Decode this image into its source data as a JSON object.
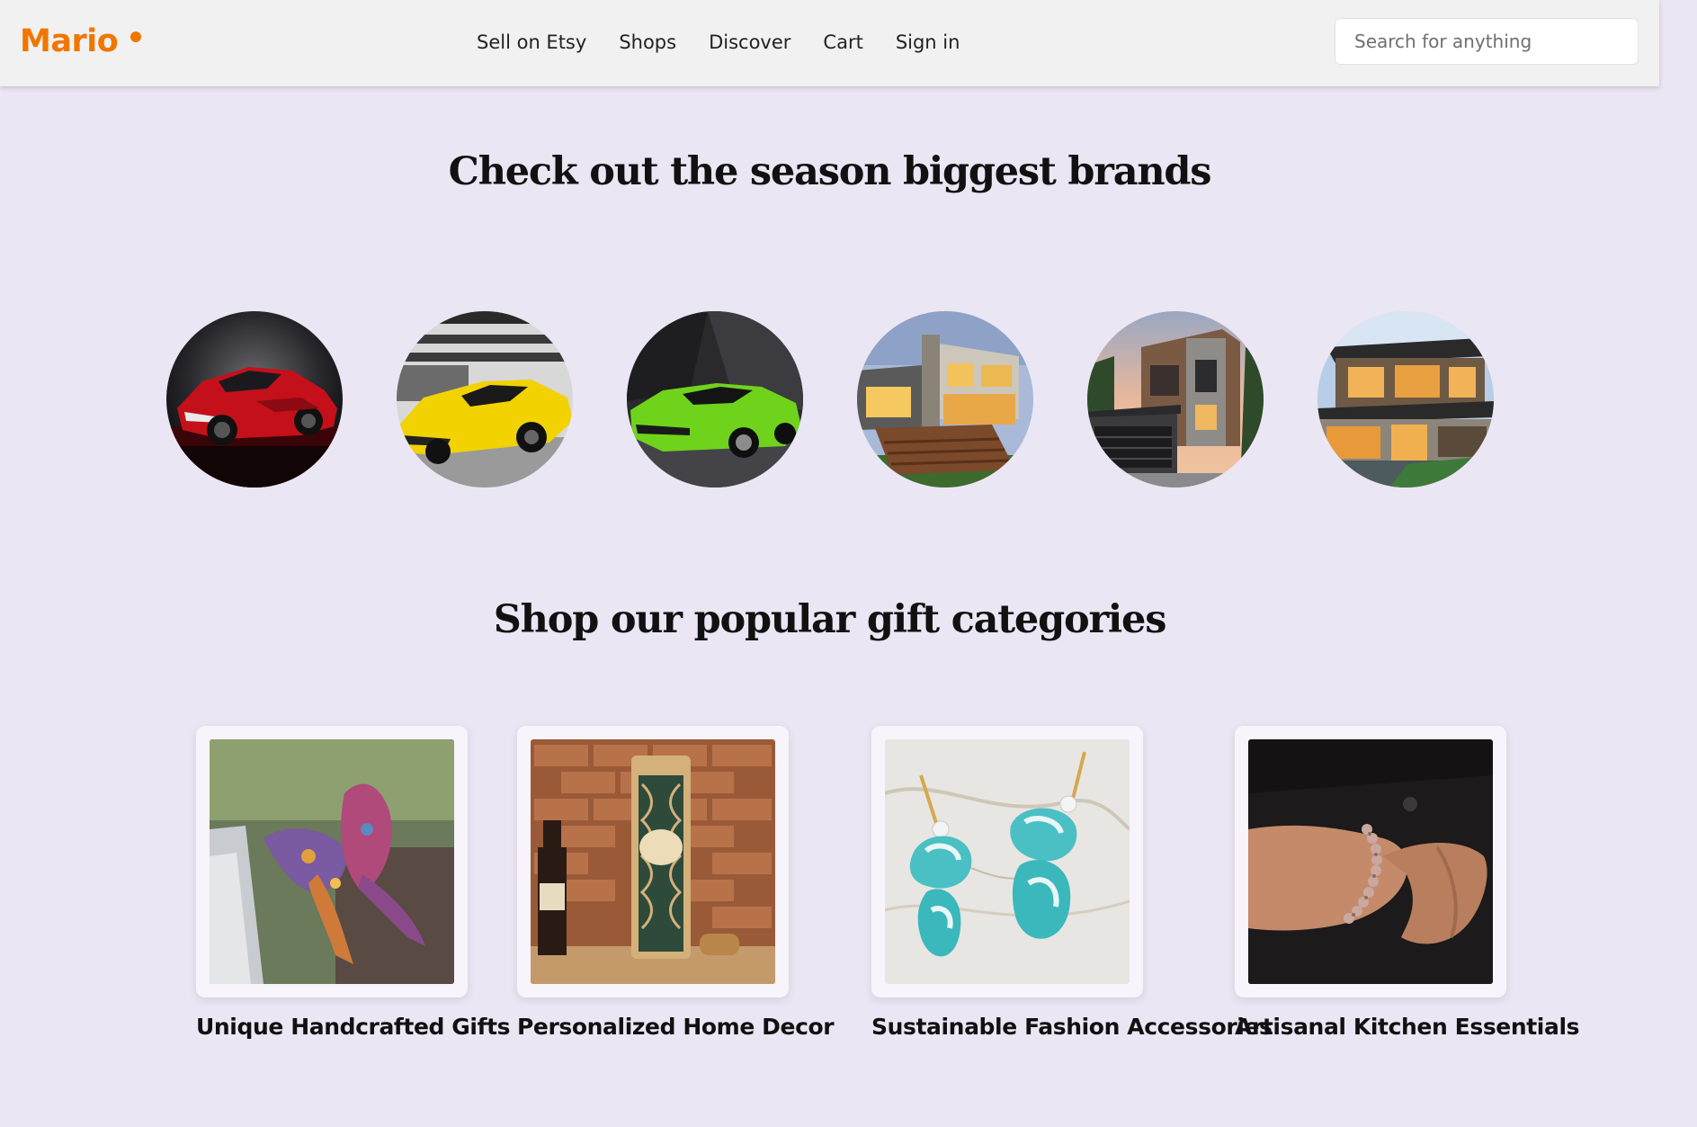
{
  "header": {
    "logo": "Mario",
    "nav": [
      "Sell on Etsy",
      "Shops",
      "Discover",
      "Cart",
      "Sign in"
    ],
    "search_placeholder": "Search for anything"
  },
  "brands": {
    "title": "Check out the season biggest brands",
    "items": [
      {
        "subject": "red sports car"
      },
      {
        "subject": "yellow sports car"
      },
      {
        "subject": "green sports car"
      },
      {
        "subject": "modern house with deck"
      },
      {
        "subject": "modern stone house at sunset"
      },
      {
        "subject": "modern house at dusk"
      }
    ]
  },
  "categories": {
    "title": "Shop our popular gift categories",
    "items": [
      {
        "label": "Unique Handcrafted Gifts"
      },
      {
        "label": "Personalized Home Decor"
      },
      {
        "label": "Sustainable Fashion Accessories"
      },
      {
        "label": "Artisanal Kitchen Essentials"
      }
    ]
  },
  "colors": {
    "accent": "#f07600",
    "page_background": "#ebe6f3",
    "header_background": "#f1f1f1"
  }
}
